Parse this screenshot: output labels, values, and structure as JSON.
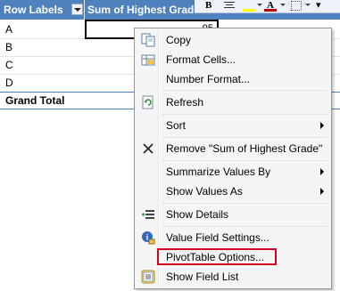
{
  "pivot": {
    "header": {
      "row_labels": "Row Labels",
      "sum_field": "Sum of Highest Grade"
    },
    "rows": [
      "A",
      "B",
      "C",
      "D"
    ],
    "grand_total": "Grand Total",
    "selected_value": "95"
  },
  "toolbar": {
    "bold": "B",
    "font_color": "A",
    "more": "▾"
  },
  "context_menu": {
    "items": [
      {
        "label": "Copy",
        "icon": "copy-icon"
      },
      {
        "label": "Format Cells...",
        "icon": "format-cells-icon"
      },
      {
        "label": "Number Format..."
      },
      {
        "label": "Refresh",
        "icon": "refresh-icon"
      },
      {
        "label": "Sort",
        "submenu": true
      },
      {
        "label": "Remove \"Sum of Highest Grade\"",
        "icon": "remove-x-icon"
      },
      {
        "label": "Summarize Values By",
        "submenu": true
      },
      {
        "label": "Show Values As",
        "submenu": true
      },
      {
        "label": "Show Details",
        "icon": "show-details-icon"
      },
      {
        "label": "Value Field Settings...",
        "icon": "value-field-settings-icon"
      },
      {
        "label": "PivotTable Options..."
      },
      {
        "label": "Show Field List",
        "icon": "field-list-icon"
      }
    ]
  },
  "colors": {
    "header_bg": "#4f81bd",
    "highlight_border": "#d0021b"
  }
}
